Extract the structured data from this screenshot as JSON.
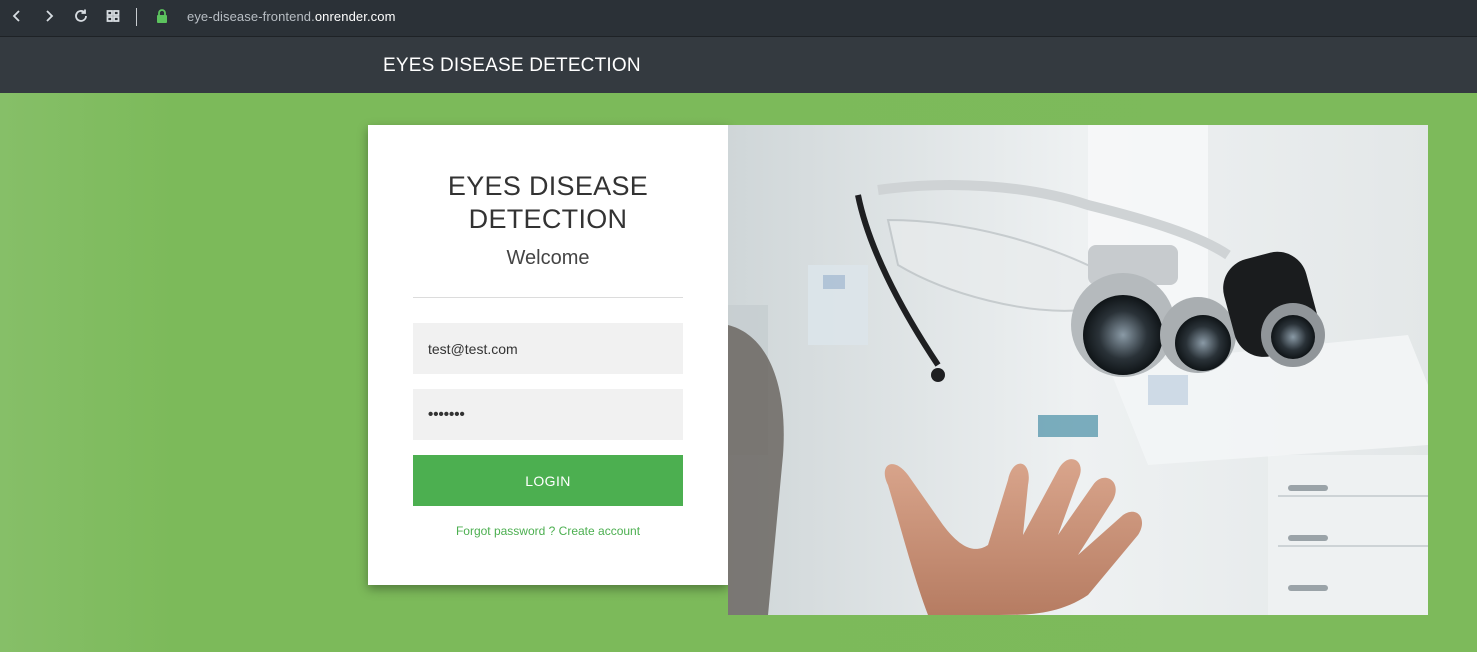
{
  "browser": {
    "url_prefix": "eye-disease-frontend.",
    "url_domain": "onrender.com"
  },
  "header": {
    "brand": "EYES DISEASE DETECTION"
  },
  "login": {
    "title_line1": "EYES DISEASE",
    "title_line2": "DETECTION",
    "welcome": "Welcome",
    "email_value": "test@test.com",
    "password_mask": "•••••••",
    "login_label": "LOGIN",
    "forgot_label": "Forgot password ?",
    "create_label": "Create account"
  },
  "colors": {
    "accent": "#4caf50",
    "background": "#7dba5c",
    "header": "#343a40",
    "browser_bar": "#2b3137"
  },
  "icons": [
    "back-icon",
    "forward-icon",
    "reload-icon",
    "apps-icon",
    "lock-icon"
  ]
}
